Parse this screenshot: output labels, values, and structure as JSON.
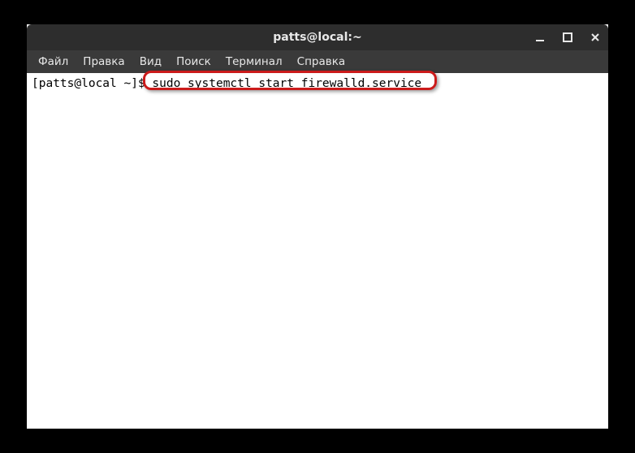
{
  "window": {
    "title": "patts@local:~"
  },
  "menu": {
    "items": [
      {
        "label": "Файл"
      },
      {
        "label": "Правка"
      },
      {
        "label": "Вид"
      },
      {
        "label": "Поиск"
      },
      {
        "label": "Терминал"
      },
      {
        "label": "Справка"
      }
    ]
  },
  "terminal": {
    "prompt": "[patts@local ~]$ ",
    "command": "sudo systemctl start firewalld.service"
  }
}
